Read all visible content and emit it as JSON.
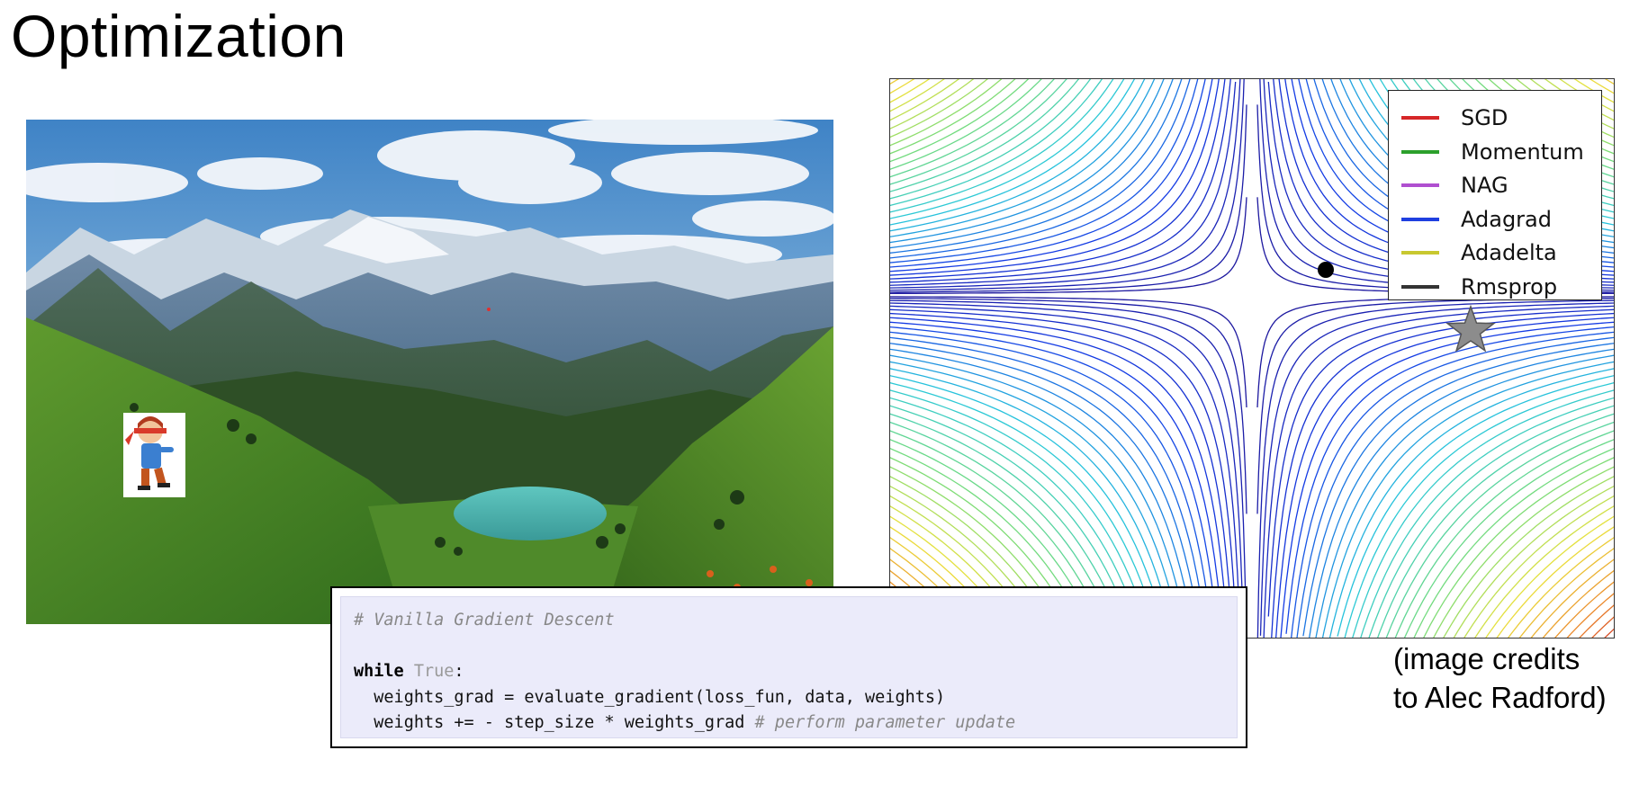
{
  "slide": {
    "title": "Optimization"
  },
  "landscape_photo": {
    "icon": "mountain-landscape-with-lake",
    "character_icon": "blindfolded-hiker-icon"
  },
  "contour_plot": {
    "legend": [
      {
        "label": "SGD",
        "color": "#d62728"
      },
      {
        "label": "Momentum",
        "color": "#2ca02c"
      },
      {
        "label": "NAG",
        "color": "#b04fd0"
      },
      {
        "label": "Adagrad",
        "color": "#1f3fe0"
      },
      {
        "label": "Adadelta",
        "color": "#c8c830"
      },
      {
        "label": "Rmsprop",
        "color": "#333333"
      }
    ],
    "markers": [
      "start-point-dot",
      "goal-star"
    ]
  },
  "code": {
    "comment": "# Vanilla Gradient Descent",
    "kw_while": "while",
    "kw_true": "True",
    "colon": ":",
    "line2": "  weights_grad = evaluate_gradient(loss_fun, data, weights)",
    "line3_code": "  weights += - step_size * weights_grad",
    "line3_comment": " # perform parameter update"
  },
  "credits": {
    "line1": "(image credits",
    "line2": "to Alec Radford)"
  }
}
